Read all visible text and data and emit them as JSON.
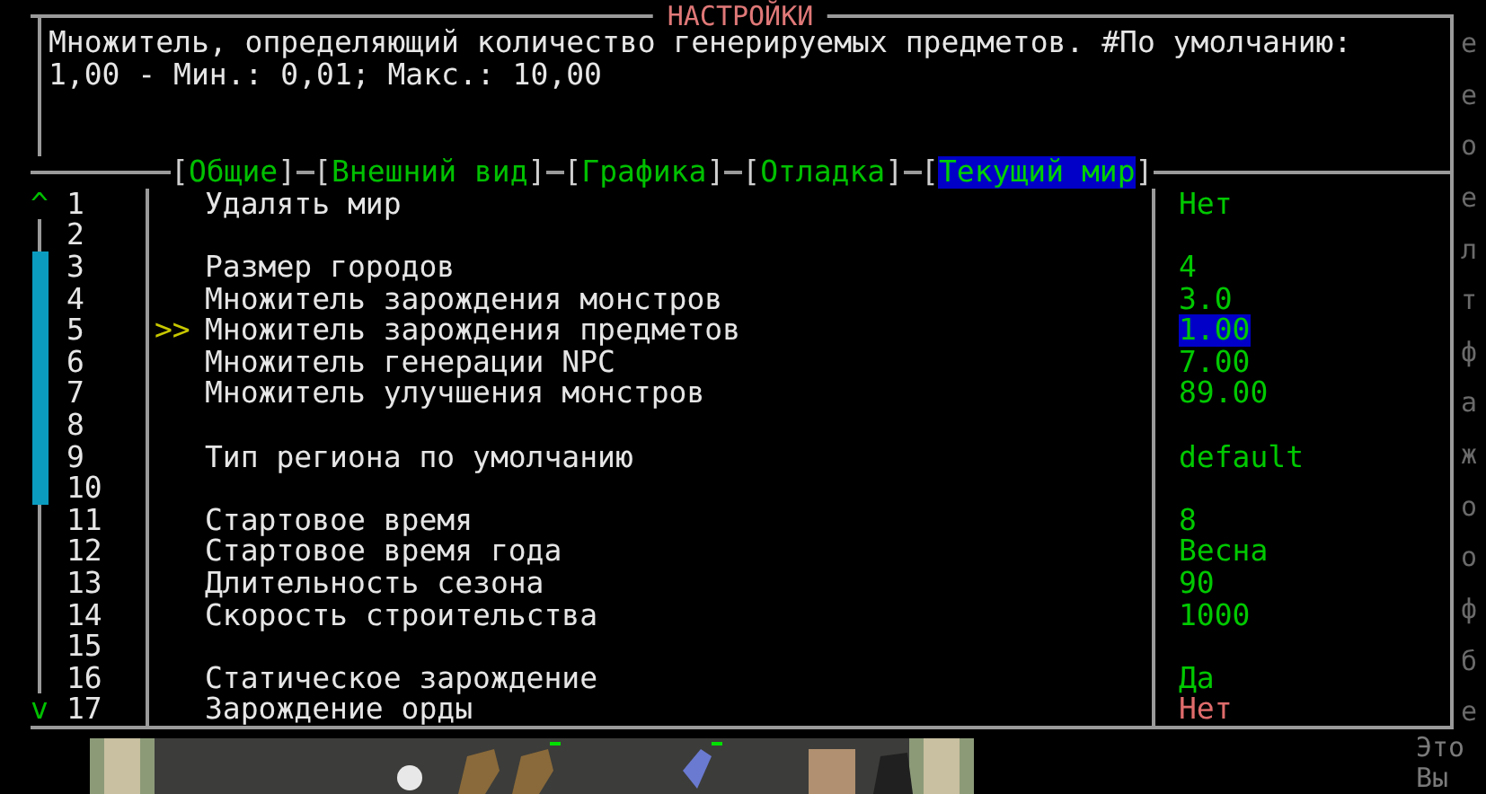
{
  "dialog": {
    "title": "НАСТРОЙКИ",
    "description": [
      "Множитель, определяющий количество генерируемых предметов. #По умолчанию:",
      "1,00 - Мин.: 0,01; Макс.: 10,00"
    ],
    "tabs": [
      {
        "open": "[",
        "label": "Общие",
        "close": "]",
        "selected": false
      },
      {
        "open": "[",
        "label": "Внешний вид",
        "close": "]",
        "selected": false
      },
      {
        "open": "[",
        "label": "Графика",
        "close": "]",
        "selected": false
      },
      {
        "open": "[",
        "label": "Отладка",
        "close": "]",
        "selected": false
      },
      {
        "open": "[",
        "label": "Текущий мир",
        "close": "]",
        "selected": true
      }
    ],
    "scroll_up": "^",
    "scroll_down": "v",
    "cursor": ">>",
    "options": [
      {
        "number": "1",
        "label": "Удалять мир",
        "value": "Нет",
        "kind": "normal",
        "selected": false
      },
      {
        "number": "2"
      },
      {
        "number": "3",
        "label": "Размер городов",
        "value": "4",
        "kind": "normal",
        "selected": false
      },
      {
        "number": "4",
        "label": "Множитель зарождения монстров",
        "value": "3.0",
        "kind": "normal",
        "selected": false
      },
      {
        "number": "5",
        "label": "Множитель зарождения предметов",
        "value": "1.00",
        "kind": "normal",
        "selected": true
      },
      {
        "number": "6",
        "label": "Множитель генерации NPC",
        "value": "7.00",
        "kind": "normal",
        "selected": false
      },
      {
        "number": "7",
        "label": "Множитель улучшения монстров",
        "value": "89.00",
        "kind": "normal",
        "selected": false
      },
      {
        "number": "8"
      },
      {
        "number": "9",
        "label": "Тип региона по умолчанию",
        "value": "default",
        "kind": "normal",
        "selected": false
      },
      {
        "number": "10"
      },
      {
        "number": "11",
        "label": "Стартовое время",
        "value": "8",
        "kind": "normal",
        "selected": false
      },
      {
        "number": "12",
        "label": "Стартовое время года",
        "value": "Весна",
        "kind": "normal",
        "selected": false
      },
      {
        "number": "13",
        "label": "Длительность сезона",
        "value": "90",
        "kind": "normal",
        "selected": false
      },
      {
        "number": "14",
        "label": "Скорость строительства",
        "value": "1000",
        "kind": "normal",
        "selected": false
      },
      {
        "number": "15"
      },
      {
        "number": "16",
        "label": "Статическое зарождение",
        "value": "Да",
        "kind": "normal",
        "selected": false
      },
      {
        "number": "17",
        "label": "Зарождение орды",
        "value": "Нет",
        "kind": "warning",
        "selected": false
      }
    ]
  },
  "background_text": [
    "е",
    "е",
    "о",
    "е",
    "л",
    "т",
    "ф",
    "а",
    "ж",
    "о",
    "о",
    "ф",
    "б",
    "е"
  ],
  "background_bottom_text": [
    "Это",
    "Вы"
  ]
}
